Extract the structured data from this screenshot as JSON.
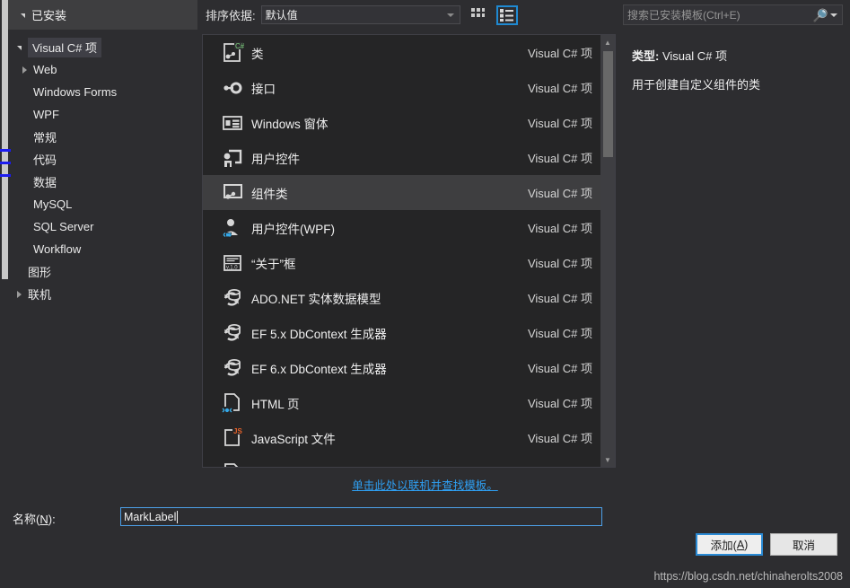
{
  "dialog": {
    "installed_header": "已安装",
    "sort": {
      "label": "排序依据:",
      "value": "默认值"
    },
    "view_buttons": {
      "tiles": "tiles-view-icon",
      "list": "list-view-icon"
    },
    "search": {
      "placeholder": "搜索已安装模板(Ctrl+E)",
      "icon": "search-icon"
    }
  },
  "tree": {
    "nodes": [
      {
        "label": "Visual C# 项",
        "indent": 0,
        "expander": "down",
        "selected": true
      },
      {
        "label": "Web",
        "indent": 1,
        "expander": "right",
        "selected": false
      },
      {
        "label": "Windows Forms",
        "indent": 1,
        "expander": "none",
        "selected": false
      },
      {
        "label": "WPF",
        "indent": 1,
        "expander": "none",
        "selected": false
      },
      {
        "label": "常规",
        "indent": 1,
        "expander": "none",
        "selected": false
      },
      {
        "label": "代码",
        "indent": 1,
        "expander": "none",
        "selected": false
      },
      {
        "label": "数据",
        "indent": 1,
        "expander": "none",
        "selected": false
      },
      {
        "label": "MySQL",
        "indent": 1,
        "expander": "none",
        "selected": false
      },
      {
        "label": "SQL Server",
        "indent": 1,
        "expander": "none",
        "selected": false
      },
      {
        "label": "Workflow",
        "indent": 1,
        "expander": "none",
        "selected": false
      },
      {
        "label": "图形",
        "indent": 0,
        "expander": "none",
        "selected": false
      },
      {
        "label": "联机",
        "indent": 0,
        "expander": "right",
        "selected": false
      }
    ]
  },
  "templates": {
    "kind_column": "Visual C# 项",
    "items": [
      {
        "name": "类",
        "kind": "Visual C# 项",
        "icon": "class-file-icon",
        "selected": false
      },
      {
        "name": "接口",
        "kind": "Visual C# 项",
        "icon": "interface-icon",
        "selected": false
      },
      {
        "name": "Windows 窗体",
        "kind": "Visual C# 项",
        "icon": "windows-form-icon",
        "selected": false
      },
      {
        "name": "用户控件",
        "kind": "Visual C# 项",
        "icon": "user-control-icon",
        "selected": false
      },
      {
        "name": "组件类",
        "kind": "Visual C# 项",
        "icon": "component-class-icon",
        "selected": true
      },
      {
        "name": "用户控件(WPF)",
        "kind": "Visual C# 项",
        "icon": "wpf-user-control-icon",
        "selected": false
      },
      {
        "name": "“关于”框",
        "kind": "Visual C# 项",
        "icon": "about-box-icon",
        "selected": false
      },
      {
        "name": "ADO.NET 实体数据模型",
        "kind": "Visual C# 项",
        "icon": "entity-model-icon",
        "selected": false
      },
      {
        "name": "EF 5.x DbContext 生成器",
        "kind": "Visual C# 项",
        "icon": "entity-model-icon",
        "selected": false
      },
      {
        "name": "EF 6.x DbContext 生成器",
        "kind": "Visual C# 项",
        "icon": "entity-model-icon",
        "selected": false
      },
      {
        "name": "HTML 页",
        "kind": "Visual C# 项",
        "icon": "html-page-icon",
        "selected": false
      },
      {
        "name": "JavaScript 文件",
        "kind": "Visual C# 项",
        "icon": "javascript-file-icon",
        "selected": false
      }
    ]
  },
  "details": {
    "type_label": "类型:",
    "type_value": "Visual C# 项",
    "description": "用于创建自定义组件的类"
  },
  "footer": {
    "online_link": "单击此处以联机并查找模板。",
    "name_label": "名称(N):",
    "name_value": "MarkLabel",
    "add_button": "添加(A)",
    "cancel_button": "取消",
    "watermark": "https://blog.csdn.net/chinaherolts2008"
  },
  "colors": {
    "dialog_bg": "#2d2d30",
    "list_bg": "#252526",
    "selection": "#3e3e40",
    "accent_blue": "#2a8ad4",
    "link_blue": "#2e9ff2"
  }
}
